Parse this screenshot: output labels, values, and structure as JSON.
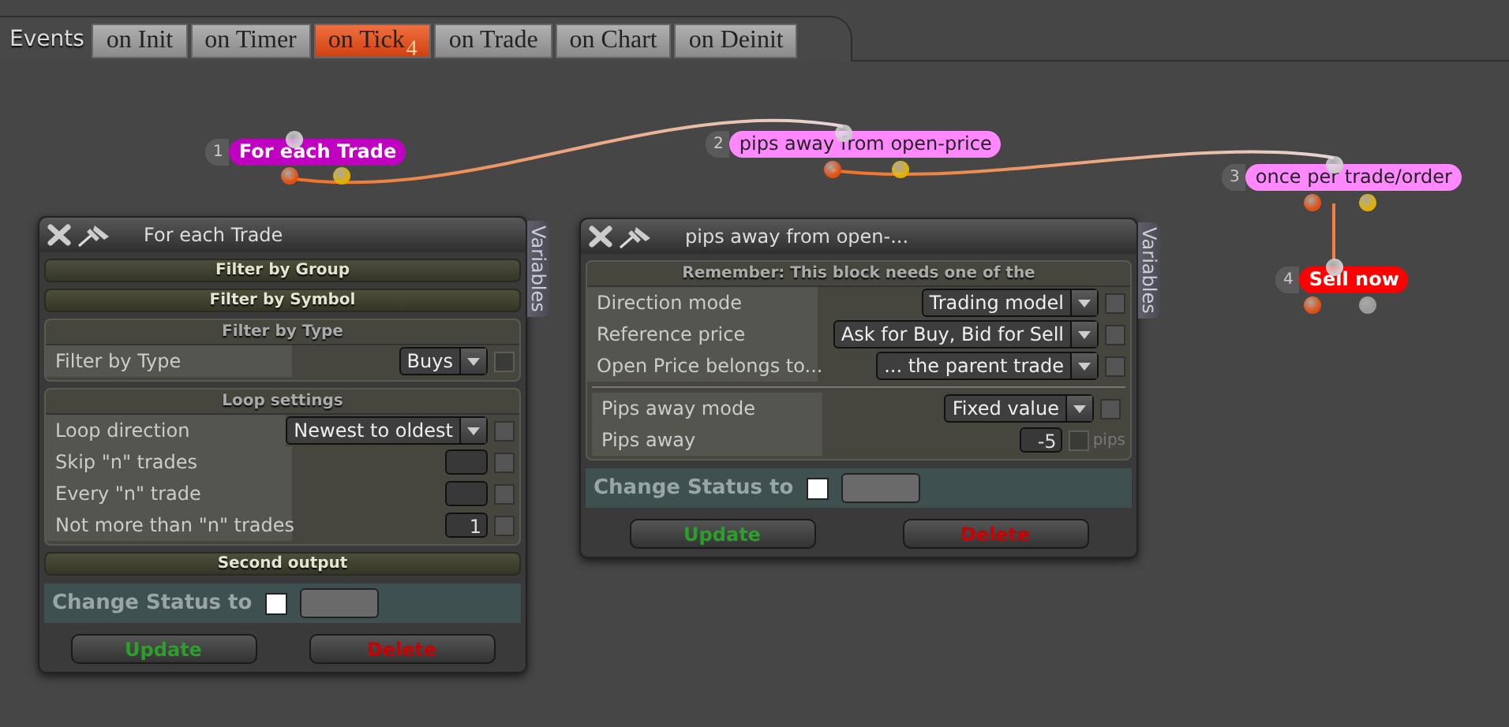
{
  "events_bar": {
    "label": "Events",
    "tabs": [
      {
        "label": "on Init",
        "selected": false
      },
      {
        "label": "on Timer",
        "selected": false
      },
      {
        "label": "on Tick",
        "selected": true,
        "badge": "4"
      },
      {
        "label": "on Trade",
        "selected": false
      },
      {
        "label": "on Chart",
        "selected": false
      },
      {
        "label": "on Deinit",
        "selected": false
      }
    ]
  },
  "nodes": [
    {
      "number": "1",
      "label": "For each Trade",
      "color": "#c000c0"
    },
    {
      "number": "2",
      "label": "pips away from open-price",
      "color": "#ff88ff"
    },
    {
      "number": "3",
      "label": "once per trade/order",
      "color": "#ff88ff"
    },
    {
      "number": "4",
      "label": "Sell now",
      "color": "#ff0000"
    }
  ],
  "panels": [
    {
      "title": "For each Trade",
      "side_tab": "Variables",
      "sections": [
        {
          "kind": "bar",
          "label": "Filter by Group"
        },
        {
          "kind": "bar",
          "label": "Filter by Symbol"
        },
        {
          "kind": "group",
          "title": "Filter by Type",
          "row_groups": [
            [
              {
                "label": "Filter by Type",
                "kind": "select",
                "value": "Buys",
                "checked": false,
                "disabled": true
              }
            ]
          ]
        },
        {
          "kind": "group",
          "title": "Loop settings",
          "row_groups": [
            [
              {
                "label": "Loop direction",
                "kind": "select",
                "value": "Newest to oldest",
                "checked": false,
                "disabled": false
              },
              {
                "label": "Skip \"n\" trades",
                "kind": "input",
                "checked": false,
                "disabled": false
              },
              {
                "label": "Every \"n\" trade",
                "kind": "input",
                "checked": false,
                "disabled": false
              },
              {
                "label": "Not more than \"n\" trades",
                "kind": "input",
                "value": "1",
                "checked": false,
                "disabled": false
              }
            ]
          ]
        },
        {
          "kind": "bar",
          "label": "Second output"
        }
      ],
      "status": {
        "label": "Change Status to",
        "checked": false
      },
      "buttons": [
        {
          "label": "Update",
          "kind": "update"
        },
        {
          "label": "Delete",
          "kind": "delete"
        }
      ]
    },
    {
      "title": "pips away from open-...",
      "side_tab": "Variables",
      "sections": [
        {
          "kind": "group",
          "title": "Remember: This block needs one of the",
          "row_groups": [
            [
              {
                "label": "Direction mode",
                "kind": "select",
                "value": "Trading model",
                "checked": false,
                "disabled": false
              },
              {
                "label": "Reference price",
                "kind": "select",
                "value": "Ask for Buy, Bid for Sell",
                "checked": false,
                "disabled": false
              },
              {
                "label": "Open Price belongs to...",
                "kind": "select",
                "value": "... the parent trade",
                "checked": false,
                "disabled": false
              }
            ],
            [
              {
                "label": "Pips away mode",
                "kind": "select",
                "value": "Fixed value",
                "checked": false,
                "disabled": false
              },
              {
                "label": "Pips away",
                "kind": "input",
                "value": "-5",
                "unit": "pips",
                "checked": false,
                "disabled": true
              }
            ]
          ]
        }
      ],
      "status": {
        "label": "Change Status to",
        "checked": false
      },
      "buttons": [
        {
          "label": "Update",
          "kind": "update"
        },
        {
          "label": "Delete",
          "kind": "delete"
        }
      ]
    }
  ]
}
